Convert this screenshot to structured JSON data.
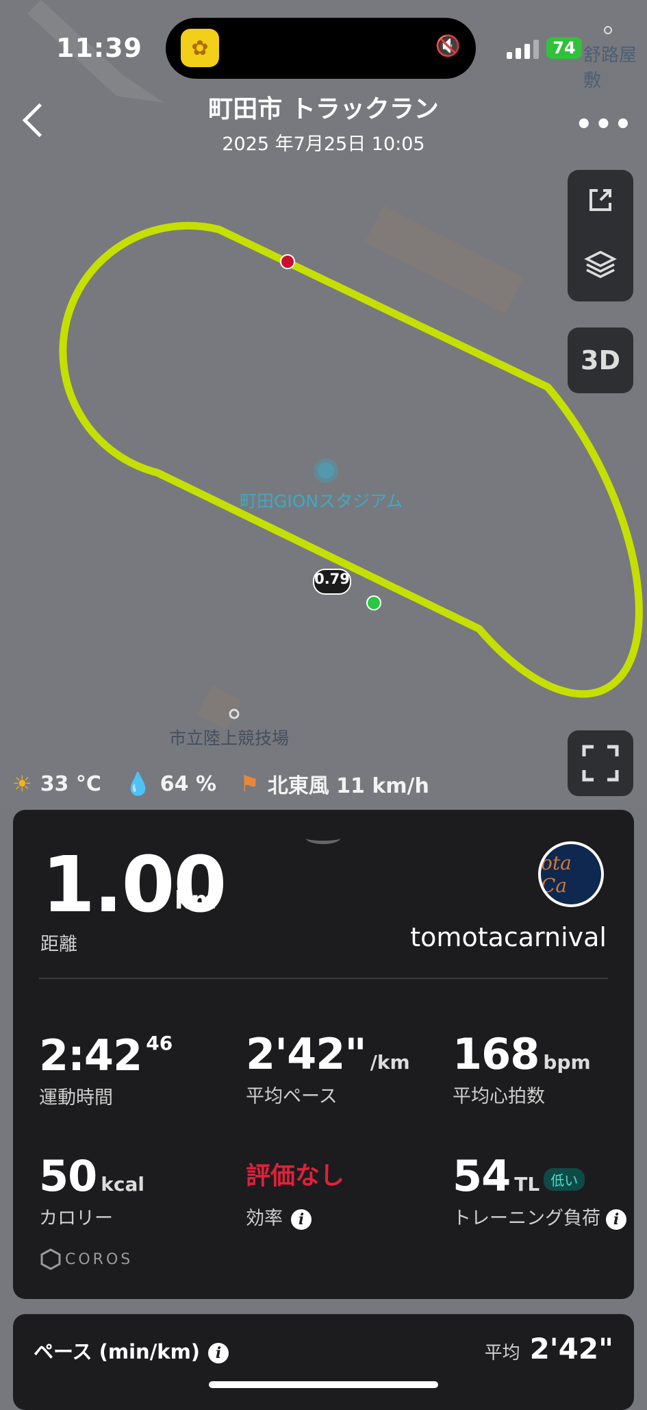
{
  "status_bar": {
    "time": "11:39",
    "battery": "74",
    "map_corner_label": "舒路屋敷"
  },
  "header": {
    "title": "町田市 トラックラン",
    "date": "2025 年7月25日 10:05"
  },
  "map": {
    "venue": "町田GIONスタジアム",
    "stadium": "市立陸上競技場",
    "km_marker": "0.79",
    "btn_3d": "3D",
    "track_color": "#c5e000",
    "start_color": "#27c93f",
    "end_color": "#c8102e"
  },
  "weather": {
    "temp": "33 °C",
    "humidity": "64 %",
    "wind": "北東風 11 km/h"
  },
  "summary": {
    "distance": "1.00",
    "distance_unit": "km",
    "distance_label": "距離",
    "username": "tomotacarnival",
    "avatar_text": "ota Ca",
    "stats": {
      "time": {
        "value": "2:42",
        "sup": "46",
        "label": "運動時間"
      },
      "pace": {
        "value": "2'42\"",
        "unit": "/km",
        "label": "平均ペース"
      },
      "hr": {
        "value": "168",
        "unit": "bpm",
        "label": "平均心拍数"
      },
      "cal": {
        "value": "50",
        "unit": "kcal",
        "label": "カロリー"
      },
      "eff": {
        "value": "評価なし",
        "label": "効率"
      },
      "load": {
        "value": "54",
        "unit": "TL",
        "badge": "低い",
        "label": "トレーニング負荷"
      }
    },
    "brand": "COROS"
  },
  "pace_section": {
    "title": "ペース (min/km)",
    "avg_label": "平均",
    "avg_value": "2'42\""
  }
}
